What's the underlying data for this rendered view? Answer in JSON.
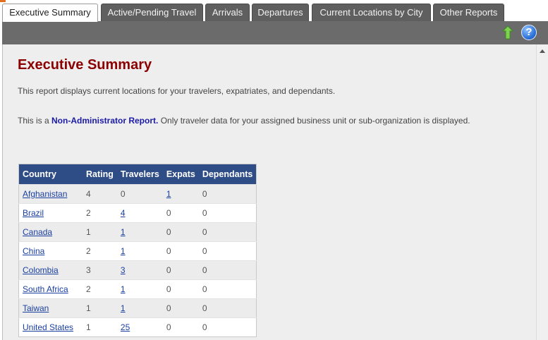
{
  "tabs": [
    {
      "label": "Executive Summary",
      "active": true
    },
    {
      "label": "Active/Pending Travel",
      "active": false
    },
    {
      "label": "Arrivals",
      "active": false
    },
    {
      "label": "Departures",
      "active": false
    },
    {
      "label": "Current Locations by City",
      "active": false
    },
    {
      "label": "Other Reports",
      "active": false
    }
  ],
  "toolbar": {
    "icons": [
      "export-icon",
      "help-icon"
    ],
    "help_glyph": "?"
  },
  "page": {
    "title": "Executive Summary",
    "description": "This report displays current locations for your travelers, expatriates, and dependants.",
    "notice_prefix": "This is a ",
    "notice_link": "Non-Administrator Report.",
    "notice_suffix": " Only traveler data for your assigned business unit or sub-organization is displayed."
  },
  "table": {
    "columns": [
      "Country",
      "Rating",
      "Travelers",
      "Expats",
      "Dependants"
    ],
    "rows": [
      {
        "country": "Afghanistan",
        "rating": "4",
        "travelers": "0",
        "expats": "1",
        "dependants": "0"
      },
      {
        "country": "Brazil",
        "rating": "2",
        "travelers": "4",
        "expats": "0",
        "dependants": "0"
      },
      {
        "country": "Canada",
        "rating": "1",
        "travelers": "1",
        "expats": "0",
        "dependants": "0"
      },
      {
        "country": "China",
        "rating": "2",
        "travelers": "1",
        "expats": "0",
        "dependants": "0"
      },
      {
        "country": "Colombia",
        "rating": "3",
        "travelers": "3",
        "expats": "0",
        "dependants": "0"
      },
      {
        "country": "South Africa",
        "rating": "2",
        "travelers": "1",
        "expats": "0",
        "dependants": "0"
      },
      {
        "country": "Taiwan",
        "rating": "1",
        "travelers": "1",
        "expats": "0",
        "dependants": "0"
      },
      {
        "country": "United States",
        "rating": "1",
        "travelers": "25",
        "expats": "0",
        "dependants": "0"
      }
    ]
  },
  "colors": {
    "title": "#8b0000",
    "header_bg": "#2e4c86",
    "link": "#1a3fa0",
    "tab_bg": "#5f5f5f",
    "toolbar_bg": "#6b6b6b"
  }
}
